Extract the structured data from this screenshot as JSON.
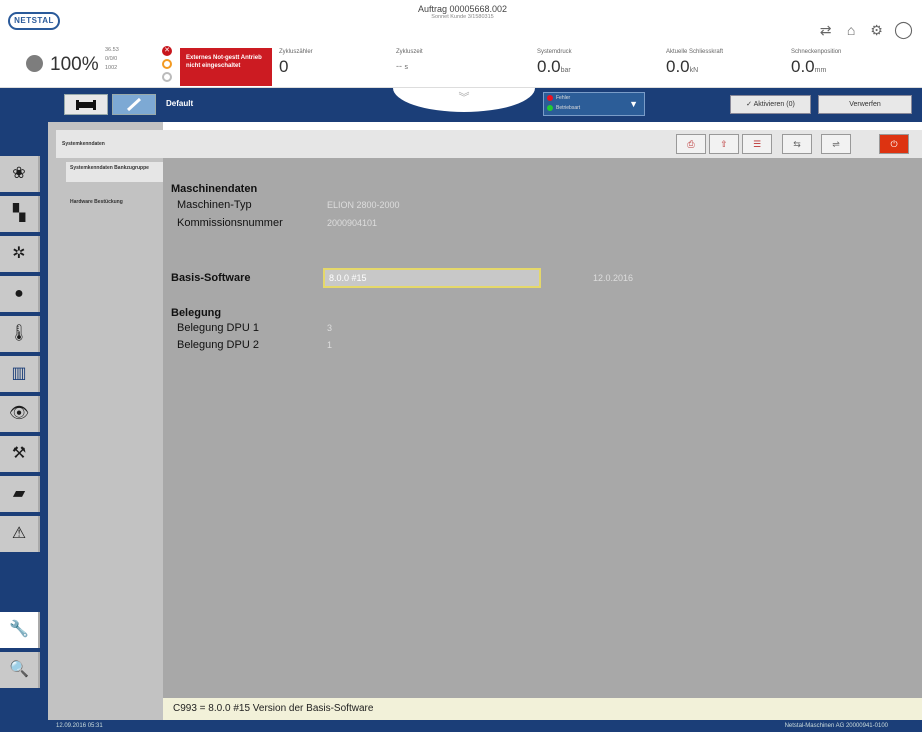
{
  "header": {
    "logo": "NETSTAL",
    "efficiency": "100%",
    "efficiency_detail": [
      "36.53",
      "0/0/0",
      "1002"
    ],
    "alarm_text": "Externes Not-gestt Antrieb nicht eingeschaltet",
    "order_title": "Auftrag 00005668.002",
    "order_subtitle": "Sonnet Kunde 3/1580315",
    "cells": [
      {
        "label": "Zykluszähler",
        "value": "0",
        "unit": ""
      },
      {
        "label": "Zykluszeit",
        "value": "--",
        "unit": "s"
      },
      {
        "label": "Systemdruck",
        "value": "0.0",
        "unit": "bar"
      },
      {
        "label": "Aktuelle Schliesskraft",
        "value": "0.0",
        "unit": "kN"
      },
      {
        "label": "Schneckenposition",
        "value": "0.0",
        "unit": "mm"
      }
    ]
  },
  "bluebar": {
    "profile": "Default",
    "status_items": [
      "Fehler",
      "Betriebsart"
    ],
    "activate_label": "✓ Aktivieren (0)",
    "discard_label": "Verwerfen"
  },
  "nav": {
    "header": "Systemkenndaten",
    "items": [
      "Systemkenndaten Bankzugruppe",
      "Hardware Bestückung"
    ]
  },
  "content": {
    "machine_section": "Maschinendaten",
    "machine_type_label": "Maschinen-Typ",
    "machine_type_value": "ELION 2800-2000",
    "commission_label": "Kommissionsnummer",
    "commission_value": "2000904101",
    "basis_label": "Basis-Software",
    "basis_value": "8.0.0 #15",
    "basis_date": "12.0.2016",
    "belegung_section": "Belegung",
    "dpu1_label": "Belegung DPU 1",
    "dpu1_value": "3",
    "dpu2_label": "Belegung DPU 2",
    "dpu2_value": "1"
  },
  "statusline": "C993 = 8.0.0 #15   Version der Basis-Software",
  "footer": {
    "datetime": "12.09.2016 05:31",
    "company": "Netstal-Maschinen AG  20000941-0100"
  }
}
